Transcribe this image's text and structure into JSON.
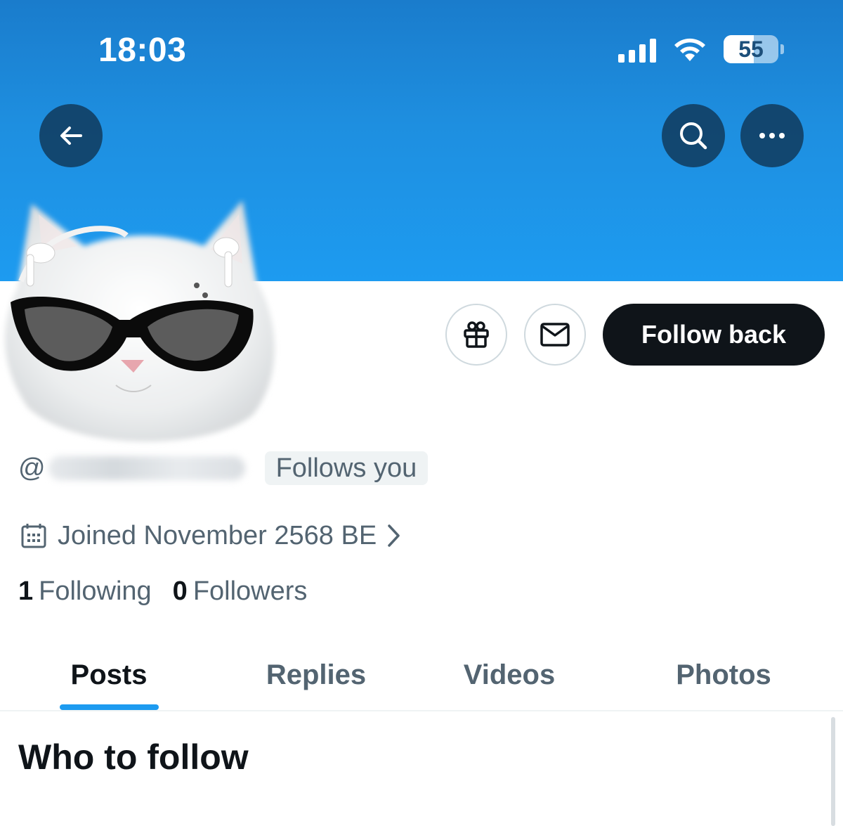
{
  "status_bar": {
    "time": "18:03",
    "battery": "55",
    "icons": [
      "signal-icon",
      "wifi-icon",
      "battery-icon"
    ]
  },
  "header": {
    "banner_color": "#1d9bf0",
    "buttons": [
      "back-arrow-icon",
      "search-icon",
      "more-icon"
    ]
  },
  "profile": {
    "handle_prefix": "@",
    "follows_you": "Follows you",
    "joined": "Joined November 2568 BE",
    "following_count": "1",
    "following_label": "Following",
    "followers_count": "0",
    "followers_label": "Followers"
  },
  "actions": {
    "gift_icon": "gift-icon",
    "mail_icon": "mail-icon",
    "follow_back_label": "Follow back"
  },
  "tabs": [
    {
      "label": "Posts",
      "active": true
    },
    {
      "label": "Replies",
      "active": false
    },
    {
      "label": "Videos",
      "active": false
    },
    {
      "label": "Photos",
      "active": false
    }
  ],
  "section": {
    "who_to_follow": "Who to follow"
  },
  "colors": {
    "accent": "#1d9bf0",
    "primary_text": "#0f1419",
    "secondary_text": "#536471"
  }
}
